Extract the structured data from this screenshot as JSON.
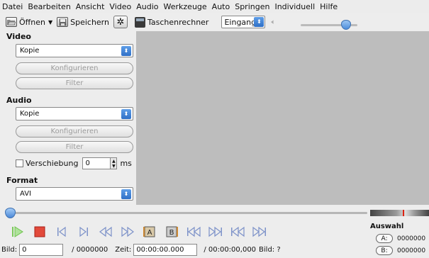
{
  "menu": [
    "Datei",
    "Bearbeiten",
    "Ansicht",
    "Video",
    "Audio",
    "Werkzeuge",
    "Auto",
    "Springen",
    "Individuell",
    "Hilfe"
  ],
  "toolbar": {
    "open_label": "Öffnen",
    "save_label": "Speichern",
    "calculator_label": "Taschenrechner",
    "input_select": "Eingang"
  },
  "volume": {
    "level": 0.8
  },
  "video": {
    "title": "Video",
    "codec": "Kopie",
    "configure_label": "Konfigurieren",
    "filter_label": "Filter"
  },
  "audio": {
    "title": "Audio",
    "codec": "Kopie",
    "configure_label": "Konfigurieren",
    "filter_label": "Filter",
    "shift_label": "Verschiebung",
    "shift_value": "0",
    "shift_unit": "ms"
  },
  "format": {
    "title": "Format",
    "value": "AVI"
  },
  "seek": {
    "position": 0.0
  },
  "selection": {
    "title": "Auswahl",
    "a_label": "A:",
    "a_value": "0000000",
    "b_label": "B:",
    "b_value": "0000000"
  },
  "status": {
    "frame_label": "Bild:",
    "frame_value": "0",
    "frame_total": "/ 0000000",
    "time_label": "Zeit:",
    "time_value": "00:00:00.000",
    "time_total": "/ 00:00:00,000",
    "frame_type": "Bild: ?"
  },
  "colors": {
    "accent": "#3b7fd6",
    "play_green": "#6cc24a",
    "stop_red": "#d9302a",
    "video_bg": "#bdbdbd"
  }
}
